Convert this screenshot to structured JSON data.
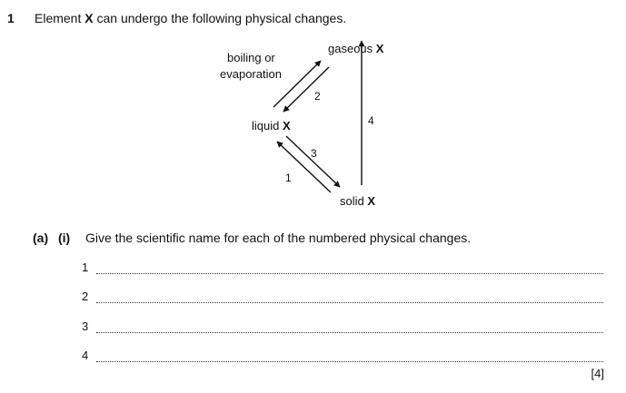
{
  "question": {
    "number": "1",
    "intro_before": "Element ",
    "element": "X",
    "intro_after": " can undergo the following physical changes."
  },
  "diagram": {
    "gas_label": "gaseous",
    "liquid_label": "liquid",
    "solid_label": "solid",
    "element": "X",
    "boiling_line1": "boiling or",
    "boiling_line2": "evaporation",
    "arrow_numbers": [
      "1",
      "2",
      "3",
      "4"
    ]
  },
  "part": {
    "label": "(a)",
    "sub_label": "(i)",
    "prompt": "Give the scientific name for each of the numbered physical changes."
  },
  "answers": [
    {
      "number": "1"
    },
    {
      "number": "2"
    },
    {
      "number": "3"
    },
    {
      "number": "4"
    }
  ],
  "marks": "[4]"
}
